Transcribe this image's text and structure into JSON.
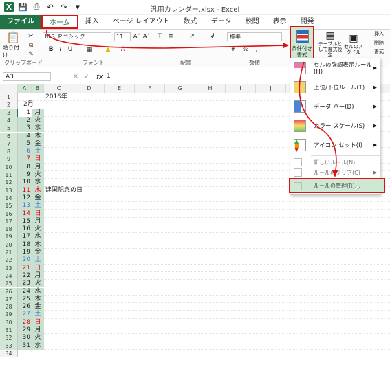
{
  "window_title": "汎用カレンダー.xlsx - Excel",
  "tabs": [
    "ファイル",
    "ホーム",
    "挿入",
    "ページ レイアウト",
    "数式",
    "データ",
    "校閲",
    "表示",
    "開発"
  ],
  "ribbon": {
    "paste": "貼り付け",
    "font_name": "ＭＳ Ｐゴシック",
    "font_size": "11",
    "number_format": "標準",
    "cond_format": "条件付き書式",
    "table_format": "テーブルとして書式設定",
    "cell_style": "セルのスタイル",
    "insert": "挿入",
    "delete": "削除",
    "format": "書式",
    "group_clipboard": "クリップボード",
    "group_font": "フォント",
    "group_align": "配置",
    "group_number": "数値"
  },
  "name_box": "A3",
  "formula_value": "1",
  "columns": [
    "A",
    "B",
    "C",
    "D",
    "E",
    "F",
    "G",
    "H",
    "I",
    "J"
  ],
  "cells": {
    "C1": "2016年",
    "A2": "2月",
    "C13": "建国記念の日"
  },
  "calendar": [
    {
      "d": "1",
      "w": "月",
      "c": ""
    },
    {
      "d": "2",
      "w": "火",
      "c": ""
    },
    {
      "d": "3",
      "w": "水",
      "c": ""
    },
    {
      "d": "4",
      "w": "木",
      "c": ""
    },
    {
      "d": "5",
      "w": "金",
      "c": ""
    },
    {
      "d": "6",
      "w": "土",
      "c": "blue"
    },
    {
      "d": "7",
      "w": "日",
      "c": "red"
    },
    {
      "d": "8",
      "w": "月",
      "c": ""
    },
    {
      "d": "9",
      "w": "火",
      "c": ""
    },
    {
      "d": "10",
      "w": "水",
      "c": ""
    },
    {
      "d": "11",
      "w": "木",
      "c": "red"
    },
    {
      "d": "12",
      "w": "金",
      "c": ""
    },
    {
      "d": "13",
      "w": "土",
      "c": "blue"
    },
    {
      "d": "14",
      "w": "日",
      "c": "red"
    },
    {
      "d": "15",
      "w": "月",
      "c": ""
    },
    {
      "d": "16",
      "w": "火",
      "c": ""
    },
    {
      "d": "17",
      "w": "水",
      "c": ""
    },
    {
      "d": "18",
      "w": "木",
      "c": ""
    },
    {
      "d": "19",
      "w": "金",
      "c": ""
    },
    {
      "d": "20",
      "w": "土",
      "c": "blue"
    },
    {
      "d": "21",
      "w": "日",
      "c": "red"
    },
    {
      "d": "22",
      "w": "月",
      "c": ""
    },
    {
      "d": "23",
      "w": "火",
      "c": ""
    },
    {
      "d": "24",
      "w": "水",
      "c": ""
    },
    {
      "d": "25",
      "w": "木",
      "c": ""
    },
    {
      "d": "26",
      "w": "金",
      "c": ""
    },
    {
      "d": "27",
      "w": "土",
      "c": "blue"
    },
    {
      "d": "28",
      "w": "日",
      "c": "red"
    },
    {
      "d": "29",
      "w": "月",
      "c": ""
    },
    {
      "d": "30",
      "w": "火",
      "c": ""
    },
    {
      "d": "31",
      "w": "水",
      "c": ""
    }
  ],
  "menu": {
    "highlight": "セルの強調表示ルール(H)",
    "topbottom": "上位/下位ルール(T)",
    "databar": "データ バー(D)",
    "colorscale": "カラー スケール(S)",
    "iconset": "アイコン セット(I)",
    "newrule": "新しいルール(N)...",
    "clearrule": "ルールのクリア(C)",
    "manage": "ルールの管理(R)..."
  }
}
